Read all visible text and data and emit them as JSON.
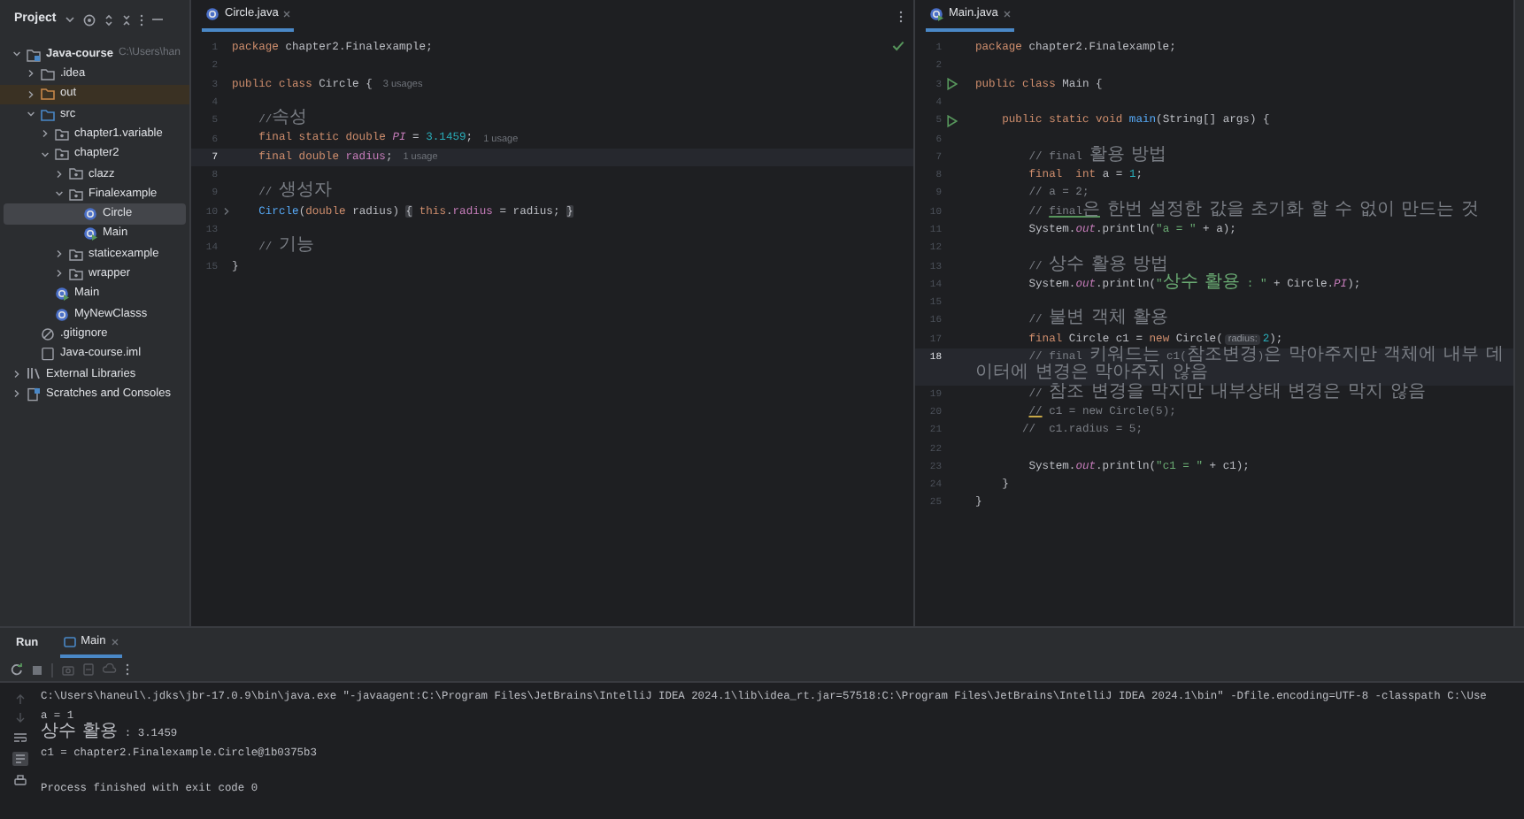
{
  "project_panel": {
    "title": "Project",
    "tree": [
      {
        "label": "Java-course",
        "hint": "C:\\Users\\han",
        "kind": "module",
        "expanded": true,
        "selected": false,
        "children": [
          {
            "label": ".idea",
            "kind": "folder",
            "expanded": false,
            "selected": false
          },
          {
            "label": "out",
            "kind": "excluded-folder",
            "expanded": false,
            "selected": false
          },
          {
            "label": "src",
            "kind": "source-folder",
            "expanded": true,
            "selected": false,
            "children": [
              {
                "label": "chapter1.variable",
                "kind": "package",
                "expanded": false,
                "selected": false
              },
              {
                "label": "chapter2",
                "kind": "package",
                "expanded": true,
                "selected": false,
                "children": [
                  {
                    "label": "clazz",
                    "kind": "package",
                    "expanded": false,
                    "selected": false
                  },
                  {
                    "label": "Finalexample",
                    "kind": "package",
                    "expanded": true,
                    "selected": false,
                    "children": [
                      {
                        "label": "Circle",
                        "kind": "class",
                        "selected": true
                      },
                      {
                        "label": "Main",
                        "kind": "main-class",
                        "selected": false
                      }
                    ]
                  },
                  {
                    "label": "staticexample",
                    "kind": "package",
                    "expanded": false,
                    "selected": false
                  },
                  {
                    "label": "wrapper",
                    "kind": "package",
                    "expanded": false,
                    "selected": false
                  }
                ]
              },
              {
                "label": "Main",
                "kind": "main-class",
                "selected": false
              },
              {
                "label": "MyNewClasss",
                "kind": "class",
                "selected": false
              }
            ]
          },
          {
            "label": ".gitignore",
            "kind": "ignore-file",
            "selected": false
          },
          {
            "label": "Java-course.iml",
            "kind": "module-file",
            "selected": false
          }
        ]
      },
      {
        "label": "External Libraries",
        "kind": "libraries",
        "expanded": false,
        "selected": false
      },
      {
        "label": "Scratches and Consoles",
        "kind": "scratches",
        "expanded": false,
        "selected": false
      }
    ]
  },
  "editors": [
    {
      "tab": {
        "label": "Circle.java",
        "kind": "class"
      },
      "inspection_ok": true,
      "lines": [
        {
          "number": "1",
          "current": false,
          "segments": [
            {
              "text": "package",
              "kind": "keyword"
            },
            {
              "text": " chapter2.Finalexample;",
              "kind": "plain"
            }
          ]
        },
        {
          "number": "2",
          "current": false
        },
        {
          "number": "3",
          "current": false,
          "segments": [
            {
              "text": "public class",
              "kind": "keyword"
            },
            {
              "text": " Circle {",
              "kind": "plain"
            }
          ],
          "hint": "3 usages"
        },
        {
          "number": "4",
          "current": false
        },
        {
          "number": "5",
          "current": false,
          "segments": [
            {
              "text": "    //속성",
              "kind": "comment"
            }
          ]
        },
        {
          "number": "6",
          "current": false,
          "segments": [
            {
              "text": "    final static double ",
              "kind": "keyword"
            },
            {
              "text": "PI",
              "kind": "static"
            },
            {
              "text": " = ",
              "kind": "plain"
            },
            {
              "text": "3.1459",
              "kind": "number"
            },
            {
              "text": ";",
              "kind": "plain"
            }
          ],
          "hint": "1 usage"
        },
        {
          "number": "7",
          "current": true,
          "segments": [
            {
              "text": "    final double ",
              "kind": "keyword"
            },
            {
              "text": "radius",
              "kind": "field"
            },
            {
              "text": ";",
              "kind": "plain"
            }
          ],
          "hint": "1 usage"
        },
        {
          "number": "8",
          "current": false
        },
        {
          "number": "9",
          "current": false,
          "segments": [
            {
              "text": "    // 생성자",
              "kind": "comment"
            }
          ]
        },
        {
          "number": "10",
          "current": false,
          "gutter": {
            "kind": "fold"
          },
          "segments": [
            {
              "text": "    Circle",
              "kind": "method"
            },
            {
              "text": "(",
              "kind": "plain"
            },
            {
              "text": "double",
              "kind": "keyword"
            },
            {
              "text": " radius) ",
              "kind": "plain"
            },
            {
              "text": "{",
              "kind": "folded"
            },
            {
              "text": " this",
              "kind": "keyword"
            },
            {
              "text": ".",
              "kind": "plain"
            },
            {
              "text": "radius",
              "kind": "field"
            },
            {
              "text": " = radius; ",
              "kind": "plain"
            },
            {
              "text": "}",
              "kind": "folded"
            }
          ]
        },
        {
          "number": "13",
          "current": false
        },
        {
          "number": "14",
          "current": false,
          "segments": [
            {
              "text": "    // 기능",
              "kind": "comment"
            }
          ]
        },
        {
          "number": "15",
          "current": false,
          "segments": [
            {
              "text": "}",
              "kind": "plain"
            }
          ]
        }
      ]
    },
    {
      "tab": {
        "label": "Main.java",
        "kind": "main-class"
      },
      "inspection_ok": false,
      "lines": [
        {
          "number": "1",
          "current": false,
          "segments": [
            {
              "text": "package",
              "kind": "keyword"
            },
            {
              "text": " chapter2.Finalexample;",
              "kind": "plain"
            }
          ]
        },
        {
          "number": "2",
          "current": false
        },
        {
          "number": "3",
          "current": false,
          "gutter": {
            "kind": "run"
          },
          "segments": [
            {
              "text": "public class",
              "kind": "keyword"
            },
            {
              "text": " Main {",
              "kind": "plain"
            }
          ]
        },
        {
          "number": "4",
          "current": false
        },
        {
          "number": "5",
          "current": false,
          "gutter": {
            "kind": "run"
          },
          "segments": [
            {
              "text": "    public static void ",
              "kind": "keyword"
            },
            {
              "text": "main",
              "kind": "method"
            },
            {
              "text": "(String[] args) {",
              "kind": "plain"
            }
          ]
        },
        {
          "number": "6",
          "current": false
        },
        {
          "number": "7",
          "current": false,
          "segments": [
            {
              "text": "        // final 활용 방법",
              "kind": "comment"
            }
          ]
        },
        {
          "number": "8",
          "current": false,
          "segments": [
            {
              "text": "        final  int",
              "kind": "keyword"
            },
            {
              "text": " a = ",
              "kind": "plain"
            },
            {
              "text": "1",
              "kind": "number"
            },
            {
              "text": ";",
              "kind": "plain"
            }
          ]
        },
        {
          "number": "9",
          "current": false,
          "segments": [
            {
              "text": "        // a = 2;",
              "kind": "comment"
            }
          ]
        },
        {
          "number": "10",
          "current": false,
          "segments": [
            {
              "text": "        // ",
              "kind": "comment"
            },
            {
              "text": "final은",
              "kind": "typo-comment"
            },
            {
              "text": " 한번 설정한 값을 초기화 할 수 없이 만드는 것",
              "kind": "comment"
            }
          ]
        },
        {
          "number": "11",
          "current": false,
          "segments": [
            {
              "text": "        System.",
              "kind": "plain"
            },
            {
              "text": "out",
              "kind": "static"
            },
            {
              "text": ".println(",
              "kind": "plain"
            },
            {
              "text": "\"a = \"",
              "kind": "string"
            },
            {
              "text": " + a);",
              "kind": "plain"
            }
          ]
        },
        {
          "number": "12",
          "current": false
        },
        {
          "number": "13",
          "current": false,
          "segments": [
            {
              "text": "        // 상수 활용 방법",
              "kind": "comment"
            }
          ]
        },
        {
          "number": "14",
          "current": false,
          "segments": [
            {
              "text": "        System.",
              "kind": "plain"
            },
            {
              "text": "out",
              "kind": "static"
            },
            {
              "text": ".println(",
              "kind": "plain"
            },
            {
              "text": "\"상수 활용 : \"",
              "kind": "string"
            },
            {
              "text": " + Circle.",
              "kind": "plain"
            },
            {
              "text": "PI",
              "kind": "static"
            },
            {
              "text": ");",
              "kind": "plain"
            }
          ]
        },
        {
          "number": "15",
          "current": false
        },
        {
          "number": "16",
          "current": false,
          "segments": [
            {
              "text": "        // 불변 객체 활용",
              "kind": "comment"
            }
          ]
        },
        {
          "number": "17",
          "current": false,
          "segments": [
            {
              "text": "        final",
              "kind": "keyword"
            },
            {
              "text": " Circle c1 = ",
              "kind": "plain"
            },
            {
              "text": "new",
              "kind": "keyword"
            },
            {
              "text": " Circle(",
              "kind": "plain"
            },
            {
              "text": "radius:",
              "kind": "param-hint"
            },
            {
              "text": "2",
              "kind": "number"
            },
            {
              "text": ");",
              "kind": "plain"
            }
          ]
        },
        {
          "number": "18",
          "current": true,
          "segments": [
            {
              "text": "        // final 키워드는 c1(참조변경)은 막아주지만 객체에 내부 데이터에 변경은 막아주지 않음",
              "kind": "comment"
            }
          ]
        },
        {
          "number": "19",
          "current": false,
          "segments": [
            {
              "text": "        // 참조 변경을 막지만 내부상태 변경은 막지 않음",
              "kind": "comment"
            }
          ]
        },
        {
          "number": "20",
          "current": false,
          "segments": [
            {
              "text": "        //",
              "kind": "warn-comment"
            },
            {
              "text": " c1 = new Circle(5);",
              "kind": "comment"
            }
          ]
        },
        {
          "number": "21",
          "current": false,
          "segments": [
            {
              "text": "       //  c1.radius = 5;",
              "kind": "comment"
            }
          ]
        },
        {
          "number": "22",
          "current": false
        },
        {
          "number": "23",
          "current": false,
          "segments": [
            {
              "text": "        System.",
              "kind": "plain"
            },
            {
              "text": "out",
              "kind": "static"
            },
            {
              "text": ".println(",
              "kind": "plain"
            },
            {
              "text": "\"c1 = \"",
              "kind": "string"
            },
            {
              "text": " + c1);",
              "kind": "plain"
            }
          ]
        },
        {
          "number": "24",
          "current": false,
          "segments": [
            {
              "text": "    }",
              "kind": "plain"
            }
          ]
        },
        {
          "number": "25",
          "current": false,
          "segments": [
            {
              "text": "}",
              "kind": "plain"
            }
          ]
        }
      ]
    }
  ],
  "run_panel": {
    "title": "Run",
    "tab": "Main",
    "output": [
      {
        "text": "C:\\Users\\haneul\\.jdks\\jbr-17.0.9\\bin\\java.exe \"-javaagent:C:\\Program Files\\JetBrains\\IntelliJ IDEA 2024.1\\lib\\idea_rt.jar=57518:C:\\Program Files\\JetBrains\\IntelliJ IDEA 2024.1\\bin\" -Dfile.encoding=UTF-8 -classpath C:\\Use",
        "kind": "command"
      },
      {
        "text": "a = 1",
        "kind": "output"
      },
      {
        "text": "상수 활용 : 3.1459",
        "kind": "output"
      },
      {
        "text": "c1 = chapter2.Finalexample.Circle@1b0375b3",
        "kind": "output"
      },
      {
        "text": "Process finished with exit code 0",
        "kind": "exit"
      }
    ]
  }
}
